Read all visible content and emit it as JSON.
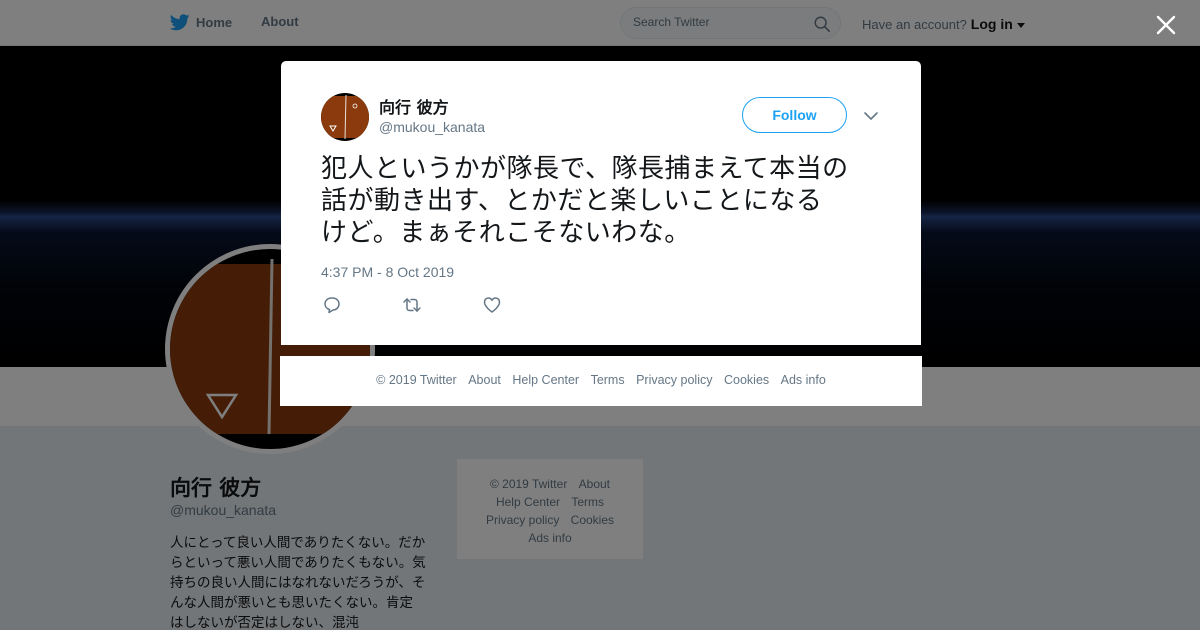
{
  "topbar": {
    "home_label": "Home",
    "about_label": "About",
    "search_placeholder": "Search Twitter",
    "account_prompt": "Have an account?",
    "login_label": "Log in"
  },
  "profile": {
    "name": "向行 彼方",
    "handle": "@mukou_kanata",
    "bio": "人にとって良い人間でありたくない。だからといって悪い人間でありたくもない。気持ちの良い人間にはなれないだろうが、そんな人間が悪いとも思いたくない。肯定はしないが否定はしない、混沌"
  },
  "side_footer": {
    "copyright": "© 2019 Twitter",
    "about": "About",
    "help_center": "Help Center",
    "terms": "Terms",
    "privacy": "Privacy policy",
    "cookies": "Cookies",
    "ads_info": "Ads info"
  },
  "tweet": {
    "author_name": "向行 彼方",
    "author_handle": "@mukou_kanata",
    "follow_label": "Follow",
    "lines": [
      "犯人というかが隊長で、隊長捕まえて本当の",
      "話が動き出す、とかだと楽しいことになる",
      "けど。まぁそれこそないわな。"
    ],
    "timestamp": "4:37 PM - 8 Oct 2019"
  },
  "modal_footer": {
    "copyright": "© 2019 Twitter",
    "about": "About",
    "help_center": "Help Center",
    "terms": "Terms",
    "privacy": "Privacy policy",
    "cookies": "Cookies",
    "ads_info": "Ads info"
  },
  "colors": {
    "brand": "#1da1f2",
    "avatar_bg": "#8a3a0c",
    "overlay": "rgba(0,0,0,0.5)"
  },
  "icons": [
    "twitter-bird-icon",
    "search-icon",
    "close-icon",
    "chevron-down-icon",
    "reply-icon",
    "retweet-icon",
    "like-icon"
  ]
}
